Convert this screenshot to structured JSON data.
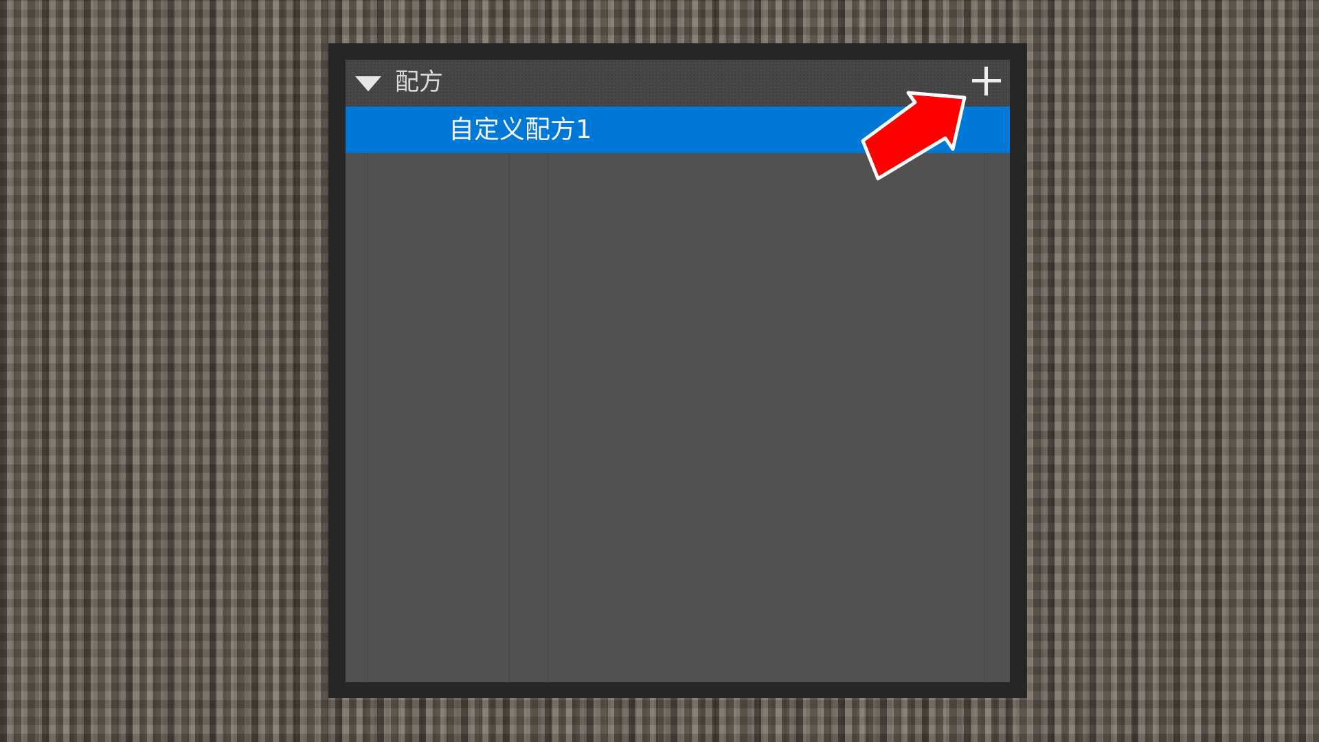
{
  "panel": {
    "header": {
      "title": "配方",
      "collapse_icon": "triangle-down-icon",
      "add_icon": "plus-icon"
    },
    "items": [
      {
        "label": "自定义配方1",
        "selected": true
      }
    ]
  },
  "annotation": {
    "icon": "red-arrow-icon",
    "color": "#ff0000",
    "outline": "#ffffff"
  },
  "colors": {
    "selection": "#0078d7",
    "panel_bg": "#515151",
    "header_bg": "#474747",
    "frame": "#262626"
  }
}
